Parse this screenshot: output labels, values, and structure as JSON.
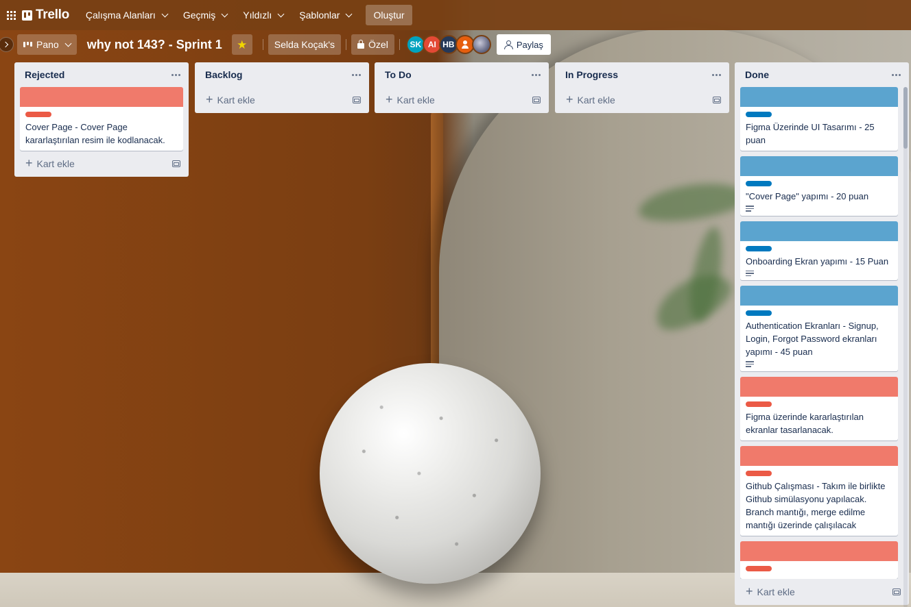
{
  "topnav": {
    "logo": "Trello",
    "items": [
      {
        "label": "Çalışma Alanları"
      },
      {
        "label": "Geçmiş"
      },
      {
        "label": "Yıldızlı"
      },
      {
        "label": "Şablonlar"
      }
    ],
    "create_label": "Oluştur"
  },
  "boardbar": {
    "view_label": "Pano",
    "title": "why not 143? - Sprint 1",
    "workspace_label": "Selda Koçak's",
    "visibility_label": "Özel",
    "share_label": "Paylaş",
    "avatars": [
      {
        "initials": "SK",
        "color": "#00a3bf"
      },
      {
        "initials": "AI",
        "color": "#e34935"
      },
      {
        "initials": "HB",
        "color": "#253858"
      },
      {
        "initials": "",
        "color": "#e65e0e"
      },
      {
        "initials": "",
        "color": "#6b6f8a"
      }
    ],
    "star_color": "#f2d600"
  },
  "lists": {
    "rejected": {
      "title": "Rejected",
      "add_label": "Kart ekle",
      "cards": [
        {
          "text": "Cover Page - Cover Page kararlaştırılan resim ile kodlanacak.",
          "cover": "#f07a6b",
          "label": "#eb5a46"
        }
      ]
    },
    "backlog": {
      "title": "Backlog",
      "add_label": "Kart ekle"
    },
    "todo": {
      "title": "To Do",
      "add_label": "Kart ekle"
    },
    "inprogress": {
      "title": "In Progress",
      "add_label": "Kart ekle"
    },
    "done": {
      "title": "Done",
      "add_label": "Kart ekle",
      "cards": [
        {
          "text": "Figma Üzerinde UI Tasarımı - 25 puan",
          "cover": "#5ba4cf",
          "label": "#0079bf",
          "has_desc": false
        },
        {
          "text": "\"Cover Page\" yapımı - 20 puan",
          "cover": "#5ba4cf",
          "label": "#0079bf",
          "has_desc": true
        },
        {
          "text": "Onboarding Ekran yapımı - 15 Puan",
          "cover": "#5ba4cf",
          "label": "#0079bf",
          "has_desc": true
        },
        {
          "text": "Authentication Ekranları - Signup, Login, Forgot Password ekranları yapımı - 45 puan",
          "cover": "#5ba4cf",
          "label": "#0079bf",
          "has_desc": true
        },
        {
          "text": "Figma üzerinde kararlaştırılan ekranlar tasarlanacak.",
          "cover": "#f07a6b",
          "label": "#eb5a46",
          "has_desc": false
        },
        {
          "text": "Github Çalışması - Takım ile birlikte Github simülasyonu yapılacak. Branch mantığı, merge edilme mantığı üzerinde çalışılacak",
          "cover": "#f07a6b",
          "label": "#eb5a46",
          "has_desc": false
        },
        {
          "text": "",
          "cover": "#f07a6b",
          "label": "#eb5a46",
          "has_desc": false
        }
      ]
    }
  }
}
